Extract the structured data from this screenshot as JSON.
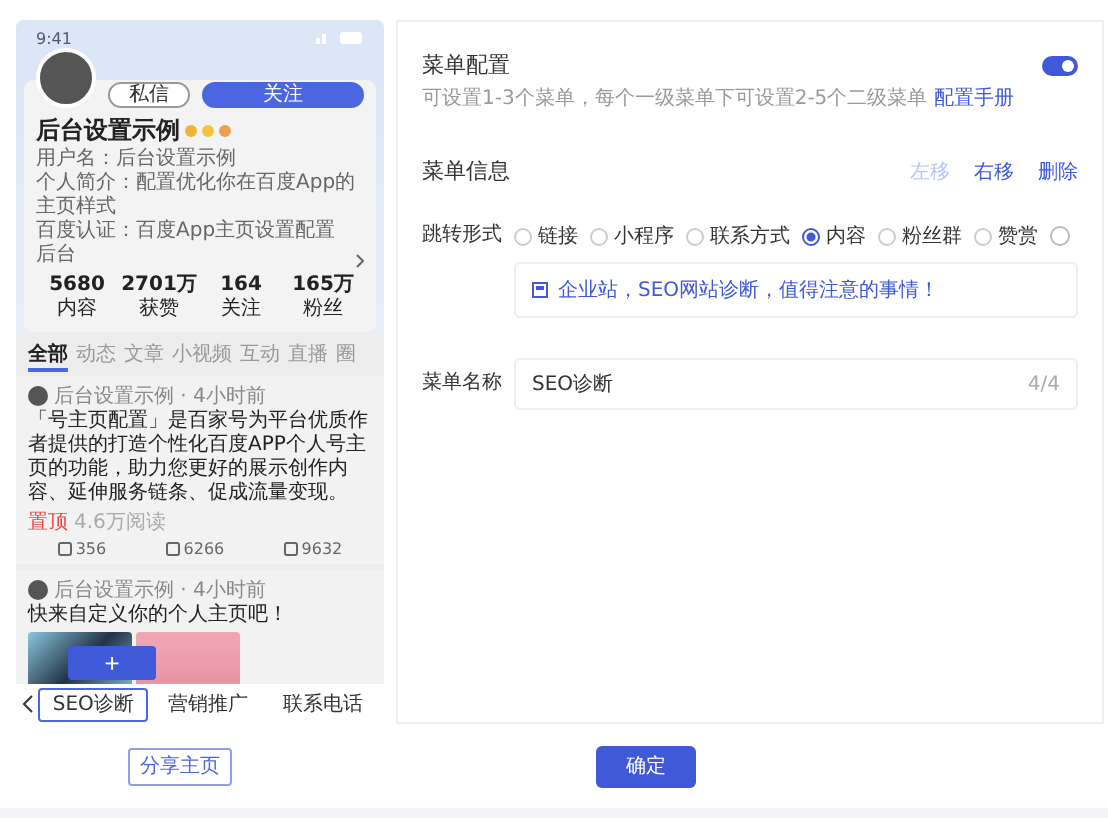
{
  "phone": {
    "status_time": "9:41",
    "profile": {
      "buttons": [
        {
          "label": "私信",
          "kind": "secondary"
        },
        {
          "label": "关注",
          "kind": "primary"
        }
      ],
      "name": "后台设置示例",
      "username": "用户名：后台设置示例",
      "intro": "个人简介：配置优化你在百度App的主页样式",
      "cert": "百度认证：百度App主页设置配置后台",
      "stats": [
        {
          "value": "5680",
          "label": "内容"
        },
        {
          "value": "2701万",
          "label": "获赞"
        },
        {
          "value": "164",
          "label": "关注"
        },
        {
          "value": "165万",
          "label": "粉丝"
        }
      ]
    },
    "tabs": [
      {
        "label": "全部",
        "selected": true
      },
      {
        "label": "动态",
        "selected": false
      },
      {
        "label": "文章",
        "selected": false
      },
      {
        "label": "小视频",
        "selected": false
      },
      {
        "label": "互动",
        "selected": false
      },
      {
        "label": "直播",
        "selected": false
      },
      {
        "label": "圈",
        "selected": false
      }
    ],
    "posts": [
      {
        "author": "后台设置示例 · 4小时前",
        "text": "「号主页配置」是百家号为平台优质作者提供的打造个性化百度APP个人号主页的功能，助力您更好的展示创作内容、延伸服务链条、促成流量变现。",
        "tag": "置顶",
        "reads": "4.6万阅读",
        "actions": [
          "356",
          "6266",
          "9632"
        ]
      },
      {
        "author": "后台设置示例 · 4小时前",
        "text": "快来自定义你的个人主页吧！",
        "images": true
      }
    ],
    "menu": {
      "add": "+",
      "items": [
        {
          "label": "SEO诊断",
          "selected": true
        },
        {
          "label": "营销推广",
          "selected": false
        },
        {
          "label": "联系电话",
          "selected": false
        }
      ]
    }
  },
  "share_button": "分享主页",
  "config": {
    "title": "菜单配置",
    "toggle_on": true,
    "description": "可设置1-3个菜单，每个一级菜单下可设置2-5个二级菜单",
    "manual_link": "配置手册",
    "info_title": "菜单信息",
    "info_actions": [
      {
        "label": "左移",
        "disabled": true
      },
      {
        "label": "右移",
        "disabled": false
      },
      {
        "label": "删除",
        "disabled": false
      }
    ],
    "jump_label": "跳转形式",
    "jump_options": [
      {
        "label": "链接",
        "selected": false
      },
      {
        "label": "小程序",
        "selected": false
      },
      {
        "label": "联系方式",
        "selected": false
      },
      {
        "label": "内容",
        "selected": true
      },
      {
        "label": "粉丝群",
        "selected": false
      },
      {
        "label": "赞赏",
        "selected": false
      }
    ],
    "content_item": "企业站，SEO网站诊断，值得注意的事情！",
    "name_label": "菜单名称",
    "name_value": "SEO诊断",
    "name_count": "4/4"
  },
  "confirm_button": "确定"
}
